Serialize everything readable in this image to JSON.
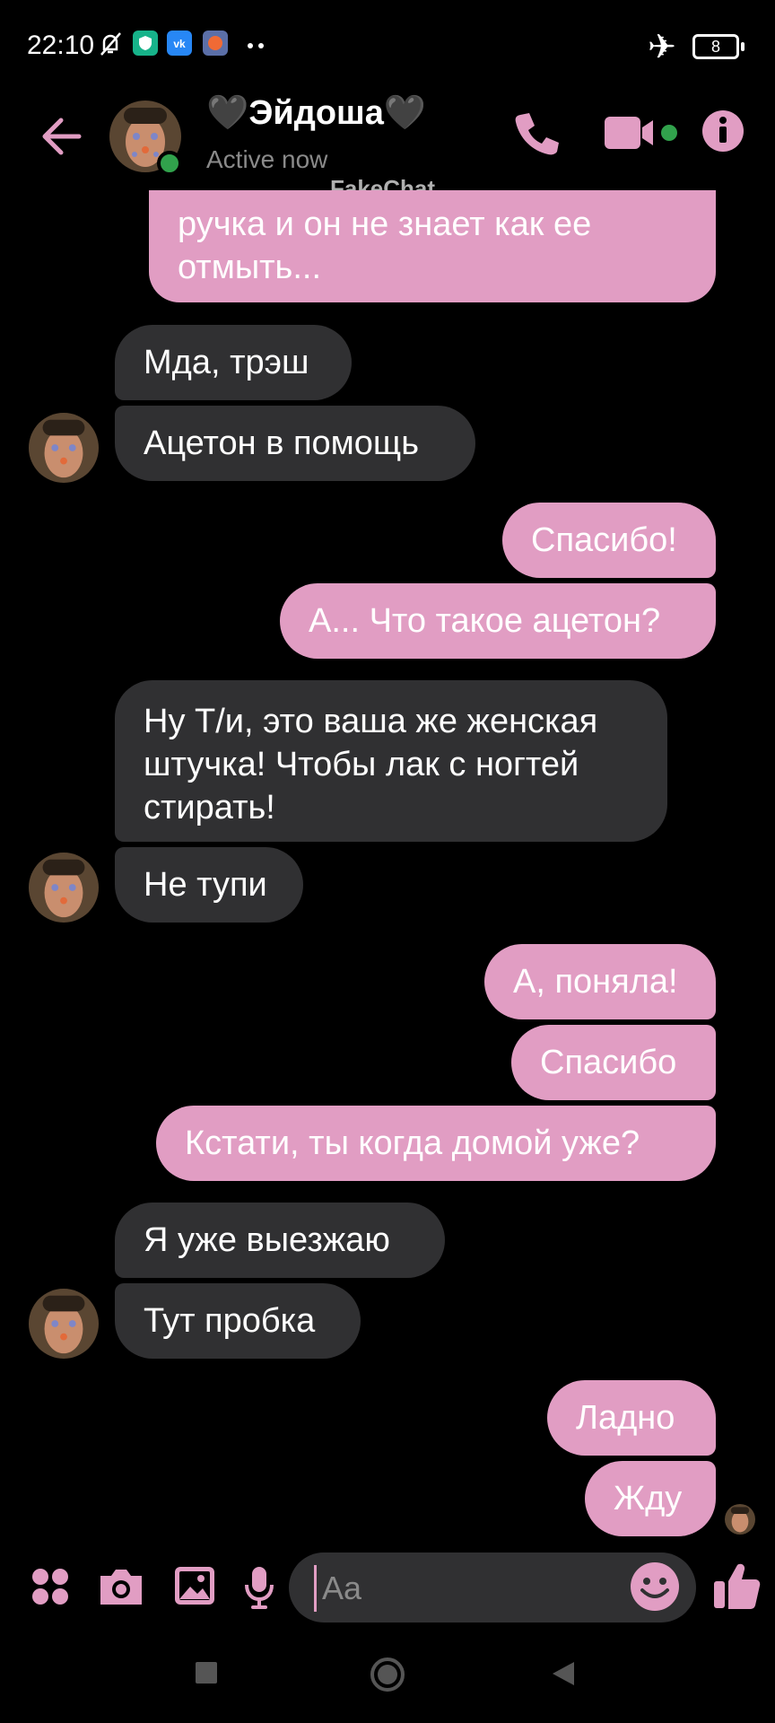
{
  "status_bar": {
    "time": "22:10",
    "battery": "8"
  },
  "header": {
    "contact_name": "🖤Эйдоша🖤",
    "contact_status": "Active now",
    "watermark": "FakeChat"
  },
  "colors": {
    "accent": "#e19dc3",
    "incoming_bubble": "#303032",
    "online": "#31a24c",
    "background": "#000000"
  },
  "messages": [
    {
      "side": "out",
      "text": "ручка и он не знает как ее отмыть..."
    },
    {
      "side": "in",
      "text": "Мда, трэш"
    },
    {
      "side": "in",
      "text": "Ацетон в помощь"
    },
    {
      "side": "out",
      "text": "Спасибо!"
    },
    {
      "side": "out",
      "text": "А... Что такое ацетон?"
    },
    {
      "side": "in",
      "text": "Ну Т/и, это ваша же женская штучка! Чтобы лак с ногтей стирать!"
    },
    {
      "side": "in",
      "text": "Не тупи"
    },
    {
      "side": "out",
      "text": "А, поняла!"
    },
    {
      "side": "out",
      "text": "Спасибо"
    },
    {
      "side": "out",
      "text": "Кстати, ты когда домой уже?"
    },
    {
      "side": "in",
      "text": "Я уже выезжаю"
    },
    {
      "side": "in",
      "text": "Тут пробка"
    },
    {
      "side": "out",
      "text": "Ладно"
    },
    {
      "side": "out",
      "text": "Жду"
    }
  ],
  "composer": {
    "placeholder": "Aa"
  },
  "icons": {
    "back": "arrow-left-icon",
    "call": "phone-icon",
    "video": "video-camera-icon",
    "info": "info-icon",
    "apps": "apps-grid-icon",
    "camera": "camera-icon",
    "gallery": "image-icon",
    "mic": "microphone-icon",
    "emoji": "emoji-icon",
    "like": "thumbs-up-icon"
  }
}
